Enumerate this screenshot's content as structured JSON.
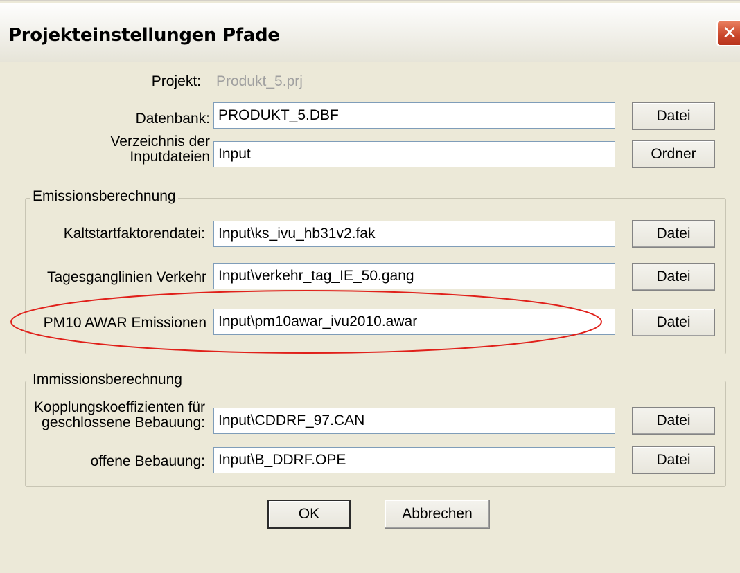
{
  "window": {
    "title": "Projekteinstellungen Pfade",
    "close_glyph": "✕"
  },
  "project": {
    "label": "Projekt:",
    "value": "Produkt_5.prj"
  },
  "database": {
    "label": "Datenbank:",
    "value": "PRODUKT_5.DBF",
    "button": "Datei"
  },
  "input_dir": {
    "label_line1": "Verzeichnis der",
    "label_line2": "Inputdateien",
    "value": "Input",
    "button": "Ordner"
  },
  "emission_group": {
    "title": "Emissionsberechnung",
    "cold_start": {
      "label": "Kaltstartfaktorendatei:",
      "value": "Input\\ks_ivu_hb31v2.fak",
      "button": "Datei"
    },
    "traffic_curves": {
      "label": "Tagesganglinien Verkehr",
      "value": "Input\\verkehr_tag_IE_50.gang",
      "button": "Datei"
    },
    "pm10": {
      "label": "PM10 AWAR Emissionen",
      "value": "Input\\pm10awar_ivu2010.awar",
      "button": "Datei"
    }
  },
  "immission_group": {
    "title": "Immissionsberechnung",
    "closed": {
      "label_line1": "Kopplungskoeffizienten für",
      "label_line2": "geschlossene Bebauung:",
      "value": "Input\\CDDRF_97.CAN",
      "button": "Datei"
    },
    "open": {
      "label": "offene Bebauung:",
      "value": "Input\\B_DDRF.OPE",
      "button": "Datei"
    }
  },
  "actions": {
    "ok": "OK",
    "cancel": "Abbrechen"
  },
  "colors": {
    "dialog_bg": "#ece9d8",
    "highlight_ellipse": "#e0201a",
    "field_border": "#7f9db9",
    "disabled_text": "#a0a0a0"
  }
}
